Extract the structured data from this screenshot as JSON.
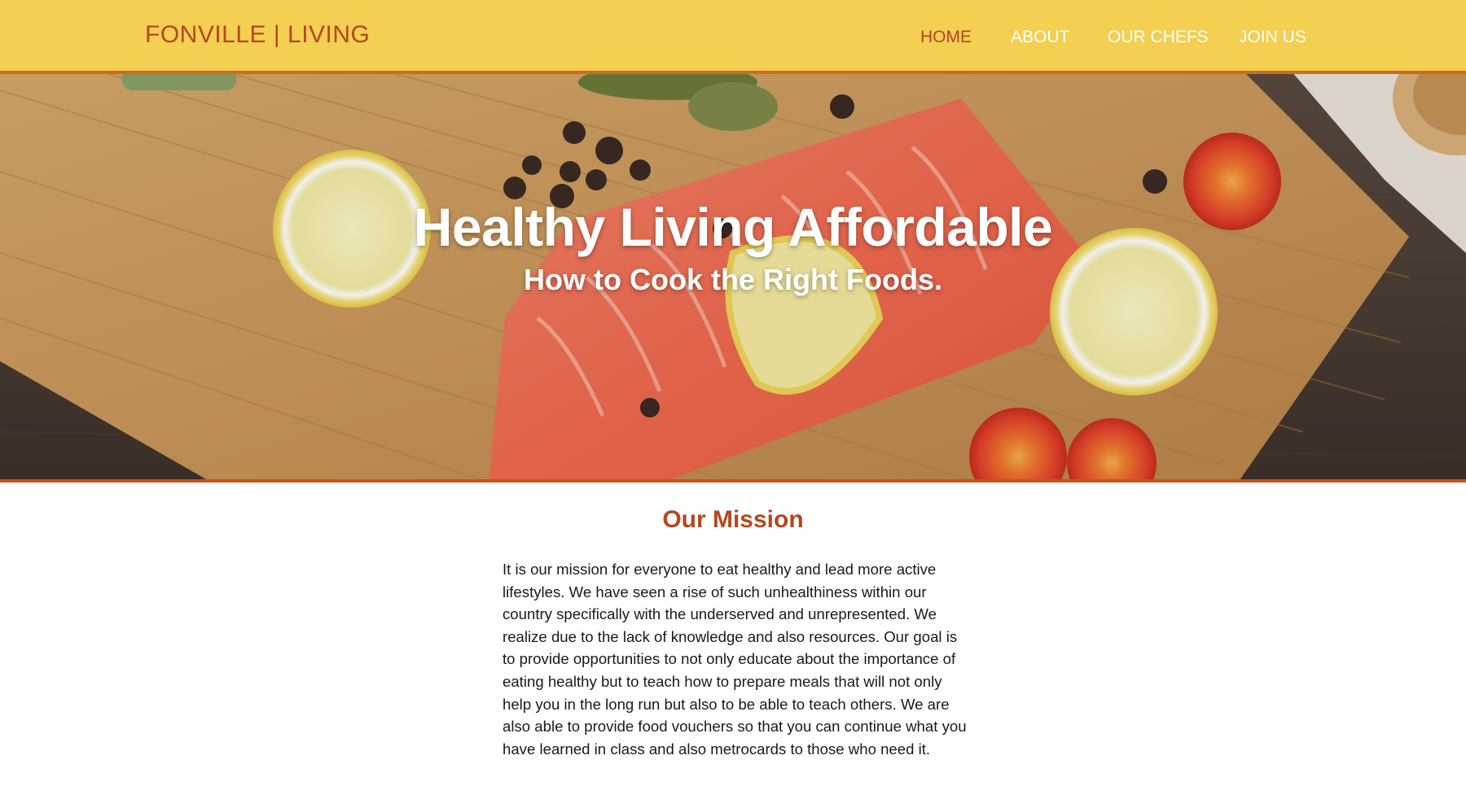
{
  "header": {
    "logo": "FONVILLE | LIVING",
    "nav": [
      {
        "label": "HOME",
        "active": true
      },
      {
        "label": "ABOUT",
        "active": false
      },
      {
        "label": "OUR CHEFS",
        "active": false
      },
      {
        "label": "JOIN US",
        "active": false
      }
    ]
  },
  "hero": {
    "title": "Healthy Living Affordable",
    "subtitle": "How to Cook the Right Foods."
  },
  "mission": {
    "title": "Our Mission",
    "body": "It is our mission for everyone to eat healthy and lead more active lifestyles. We have seen a rise of such unhealthiness within our country specifically with the underserved and unrepresented. We realize due to the lack of knowledge and also resources. Our goal is to provide opportunities to not only educate about the importance of eating healthy but to teach how to prepare meals that will not only help you in the long run but also to be able to teach others. We are also able to provide food vouchers so that you can continue what you have learned in class and also metrocards to those who need it."
  },
  "colors": {
    "header_bg": "#f3cf52",
    "accent": "#b5471e",
    "border": "#d2691e"
  }
}
